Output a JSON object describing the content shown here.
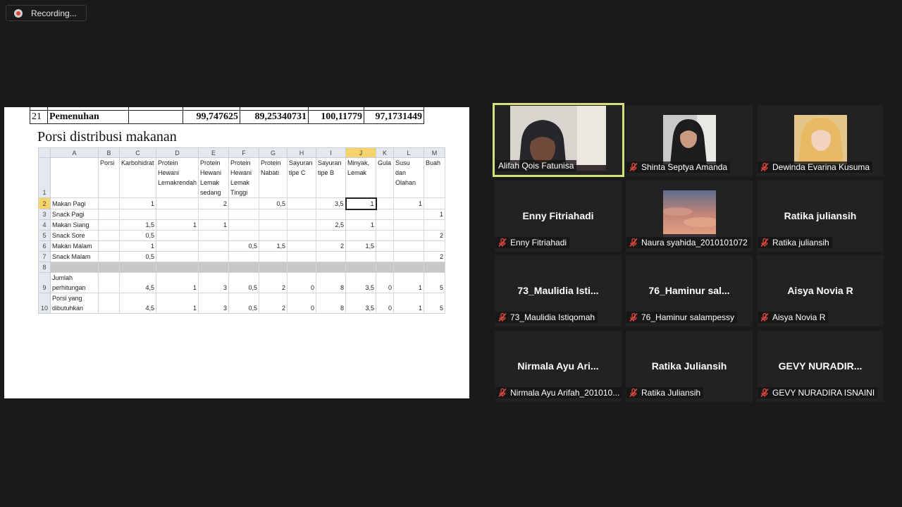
{
  "recording": {
    "label": "Recording..."
  },
  "shared_document": {
    "summary_row": {
      "row_number": "21",
      "label": "Pemenuhan",
      "values": [
        "",
        "99,747625",
        "89,25340731",
        "100,11779",
        "97,1731449"
      ]
    },
    "title": "Porsi distribusi makanan",
    "spreadsheet": {
      "column_letters": [
        "",
        "A",
        "B",
        "C",
        "D",
        "E",
        "F",
        "G",
        "H",
        "I",
        "J",
        "K",
        "L",
        "M"
      ],
      "header_row": {
        "row_number": "1",
        "cells": [
          "",
          "Porsi",
          "Karbohidrat",
          "Protein Hewani Lemakrendah",
          "Protein Hewani Lemak sedang",
          "Protein Hewani Lemak Tinggi",
          "Protein Nabati",
          "Sayuran tipe C",
          "Sayuran tipe B",
          "Minyak, Lemak",
          "Gula",
          "Susu dan Olahan",
          "Buah"
        ]
      },
      "rows": [
        {
          "n": "2",
          "cells": [
            "Makan Pagi",
            "",
            "1",
            "",
            "2",
            "",
            "0,5",
            "",
            "3,5",
            "1",
            "",
            "1",
            ""
          ]
        },
        {
          "n": "3",
          "cells": [
            "Snack Pagi",
            "",
            "",
            "",
            "",
            "",
            "",
            "",
            "",
            "",
            "",
            "",
            "1"
          ]
        },
        {
          "n": "4",
          "cells": [
            "Makan Siang",
            "",
            "1,5",
            "1",
            "1",
            "",
            "",
            "",
            "2,5",
            "1",
            "",
            "",
            ""
          ]
        },
        {
          "n": "5",
          "cells": [
            "Snack Sore",
            "",
            "0,5",
            "",
            "",
            "",
            "",
            "",
            "",
            "",
            "",
            "",
            "2"
          ]
        },
        {
          "n": "6",
          "cells": [
            "Makan Malam",
            "",
            "1",
            "",
            "",
            "0,5",
            "1,5",
            "",
            "2",
            "1,5",
            "",
            "",
            ""
          ]
        },
        {
          "n": "7",
          "cells": [
            "Snack Malam",
            "",
            "0,5",
            "",
            "",
            "",
            "",
            "",
            "",
            "",
            "",
            "",
            "2"
          ]
        },
        {
          "n": "8",
          "cells": [
            "",
            "",
            "",
            "",
            "",
            "",
            "",
            "",
            "",
            "",
            "",
            "",
            ""
          ]
        },
        {
          "n": "9",
          "cells": [
            "Jumlah perhitungan",
            "",
            "4,5",
            "1",
            "3",
            "0,5",
            "2",
            "0",
            "8",
            "3,5",
            "0",
            "1",
            "5"
          ]
        },
        {
          "n": "10",
          "cells": [
            "Porsi yang dibutuhkan",
            "",
            "4,5",
            "1",
            "3",
            "0,5",
            "2",
            "0",
            "8",
            "3,5",
            "0",
            "1",
            "5"
          ]
        }
      ]
    }
  },
  "participants": [
    {
      "tile_title": "",
      "label": "Alifah Qois Fatunisa",
      "muted": false,
      "active": true,
      "video": "webcam"
    },
    {
      "tile_title": "",
      "label": "Shinta Septya Amanda",
      "muted": true,
      "active": false,
      "video": "photo-hijab-dark"
    },
    {
      "tile_title": "",
      "label": "Dewinda Evarina Kusuma",
      "muted": true,
      "active": false,
      "video": "photo-hijab-yellow"
    },
    {
      "tile_title": "Enny Fitriahadi",
      "label": "Enny Fitriahadi",
      "muted": true,
      "active": false,
      "video": ""
    },
    {
      "tile_title": "",
      "label": "Naura syahida_2010101072",
      "muted": true,
      "active": false,
      "video": "photo-sunset-sky"
    },
    {
      "tile_title": "Ratika juliansih",
      "label": "Ratika juliansih",
      "muted": true,
      "active": false,
      "video": ""
    },
    {
      "tile_title": "73_Maulidia Isti...",
      "label": "73_Maulidia Istiqomah",
      "muted": true,
      "active": false,
      "video": ""
    },
    {
      "tile_title": "76_Haminur sal...",
      "label": "76_Haminur salampessy",
      "muted": true,
      "active": false,
      "video": ""
    },
    {
      "tile_title": "Aisya Novia R",
      "label": "Aisya Novia R",
      "muted": true,
      "active": false,
      "video": ""
    },
    {
      "tile_title": "Nirmala Ayu Ari...",
      "label": "Nirmala Ayu Arifah_201010...",
      "muted": true,
      "active": false,
      "video": ""
    },
    {
      "tile_title": "Ratika Juliansih",
      "label": "Ratika Juliansih",
      "muted": true,
      "active": false,
      "video": ""
    },
    {
      "tile_title": "GEVY NURADIR...",
      "label": "GEVY NURADIRA ISNAINI",
      "muted": true,
      "active": false,
      "video": ""
    }
  ],
  "colors": {
    "background": "#1a1a1a",
    "tile": "#222222",
    "active_border": "#d5e07a",
    "mute_icon": "#e5483c",
    "selected_header": "#f7d46a"
  }
}
